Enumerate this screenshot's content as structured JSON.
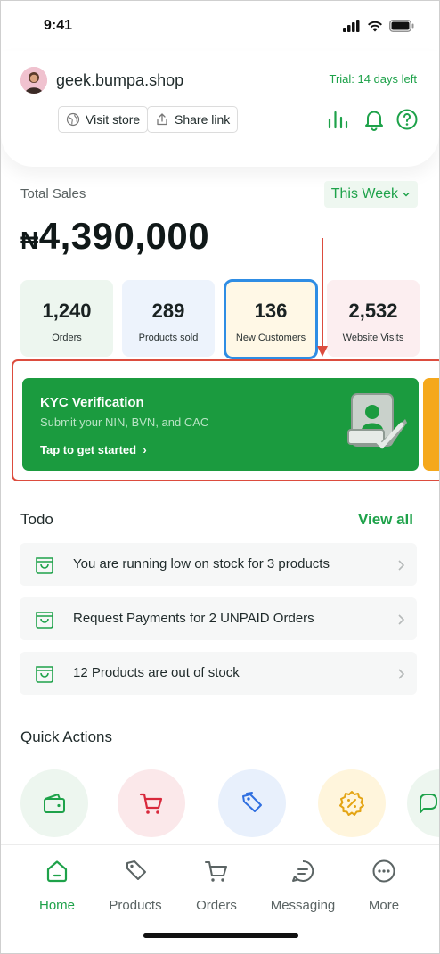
{
  "status": {
    "time": "9:41"
  },
  "header": {
    "shop_name": "geek.bumpa.shop",
    "trial": "Trial: 14 days left",
    "visit_store": "Visit store",
    "share_link": "Share link"
  },
  "sales": {
    "label": "Total Sales",
    "period": "This Week",
    "currency": "₦",
    "amount": "4,390,000"
  },
  "stats": [
    {
      "value": "1,240",
      "label": "Orders",
      "color": "#edf6ef"
    },
    {
      "value": "289",
      "label": "Products sold",
      "color": "#edf3fc"
    },
    {
      "value": "136",
      "label": "New Customers",
      "color": "#fff8e6"
    },
    {
      "value": "2,532",
      "label": "Website Visits",
      "color": "#fceef0"
    }
  ],
  "kyc": {
    "title": "KYC Verification",
    "subtitle": "Submit your NIN, BVN, and CAC",
    "cta": "Tap to get started"
  },
  "todo": {
    "title": "Todo",
    "view_all": "View all",
    "items": [
      "You are running low on stock for 3 products",
      "Request Payments for 2 UNPAID Orders",
      "12 Products are out of stock"
    ]
  },
  "quick_actions": {
    "title": "Quick Actions",
    "icons": [
      "wallet-icon",
      "cart-icon",
      "tags-icon",
      "discount-icon",
      "chat-icon"
    ]
  },
  "nav": {
    "items": [
      {
        "label": "Home",
        "icon": "home-icon"
      },
      {
        "label": "Products",
        "icon": "tag-icon"
      },
      {
        "label": "Orders",
        "icon": "cart-icon"
      },
      {
        "label": "Messaging",
        "icon": "message-icon"
      },
      {
        "label": "More",
        "icon": "more-icon"
      }
    ]
  },
  "colors": {
    "accent": "#1ea24a",
    "kyc_bg": "#1b9b3f",
    "highlight_border": "#dc4c3e",
    "selected_card_border": "#2f8de4"
  }
}
